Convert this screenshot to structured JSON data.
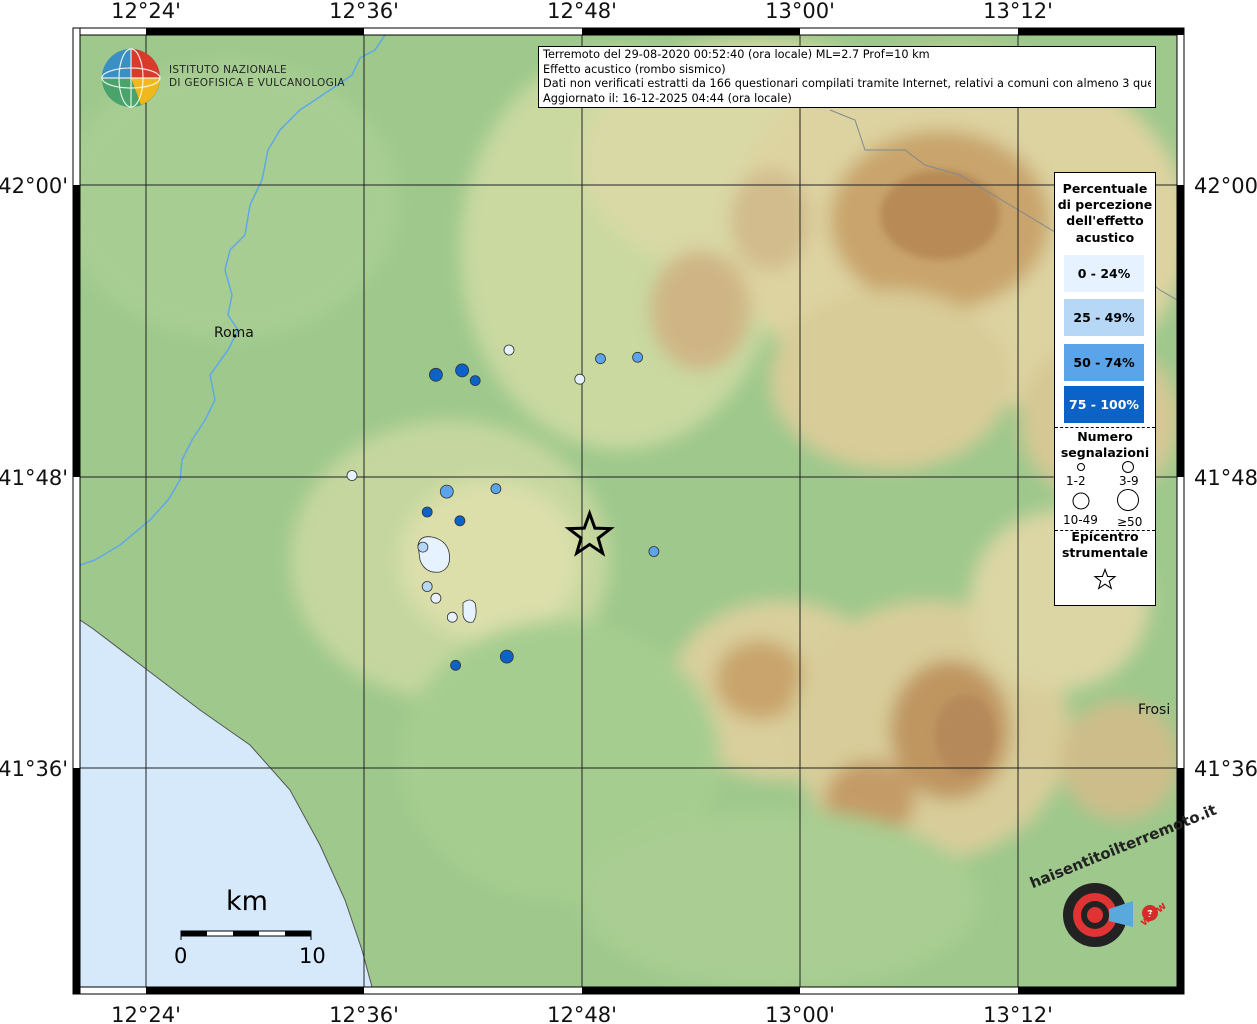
{
  "info": {
    "line1": "Terremoto del 29-08-2020 00:52:40 (ora locale) ML=2.7 Prof=10 km",
    "line2": "Effetto acustico (rombo sismico)",
    "line3": "Dati non verificati estratti da 166 questionari compilati tramite Internet, relativi a comuni con almeno 3 questionari.",
    "line4": "Aggiornato il: 16-12-2025 04:44 (ora locale)"
  },
  "institute": {
    "line1": "ISTITUTO NAZIONALE",
    "line2": "DI GEOFISICA E VULCANOLOGIA"
  },
  "axes": {
    "top": [
      "12°24'",
      "12°36'",
      "12°48'",
      "13°00'",
      "13°12'"
    ],
    "bottom": [
      "12°24'",
      "12°36'",
      "12°48'",
      "13°00'",
      "13°12'"
    ],
    "left": [
      "42°00'",
      "41°48'",
      "41°36'"
    ],
    "right": [
      "42°00'",
      "41°48'",
      "41°36'"
    ]
  },
  "places": {
    "roma": "Roma",
    "frosinone": "Frosi"
  },
  "legend": {
    "title1": "Percentuale",
    "title2": "di percezione",
    "title3": "dell'effetto",
    "title4": "acustico",
    "class1": "0 - 24%",
    "class2": "25 - 49%",
    "class3": "50 - 74%",
    "class4": "75 - 100%",
    "count_title1": "Numero",
    "count_title2": "segnalazioni",
    "size1": "1-2",
    "size2": "3-9",
    "size3": "10-49",
    "size4": "≥50",
    "epi_title1": "Epicentro",
    "epi_title2": "strumentale"
  },
  "colors": {
    "class1": "#e6f2ff",
    "class2": "#b7d7f7",
    "class3": "#5ba4ea",
    "class4": "#0c63c7",
    "sea": "#d5e9fb",
    "lakes": "#e6f2ff",
    "river": "#5fa8e8"
  },
  "scalebar": {
    "unit": "km",
    "min": "0",
    "max": "10"
  },
  "logo2": {
    "text": "haisentitoilterremoto.it",
    "url": "www"
  },
  "observations": [
    {
      "lon": 12.589,
      "lat": 41.801,
      "class": 1,
      "count_class": "1-2"
    },
    {
      "lon": 12.733,
      "lat": 41.887,
      "class": 1,
      "count_class": "1-2"
    },
    {
      "lon": 12.798,
      "lat": 41.867,
      "class": 1,
      "count_class": "1-2"
    },
    {
      "lon": 12.817,
      "lat": 41.881,
      "class": 3,
      "count_class": "1-2"
    },
    {
      "lon": 12.851,
      "lat": 41.882,
      "class": 3,
      "count_class": "1-2"
    },
    {
      "lon": 12.69,
      "lat": 41.873,
      "class": 4,
      "count_class": "3-9"
    },
    {
      "lon": 12.666,
      "lat": 41.87,
      "class": 4,
      "count_class": "3-9"
    },
    {
      "lon": 12.702,
      "lat": 41.866,
      "class": 4,
      "count_class": "1-2"
    },
    {
      "lon": 12.676,
      "lat": 41.79,
      "class": 3,
      "count_class": "3-9"
    },
    {
      "lon": 12.721,
      "lat": 41.792,
      "class": 3,
      "count_class": "1-2"
    },
    {
      "lon": 12.658,
      "lat": 41.776,
      "class": 4,
      "count_class": "1-2"
    },
    {
      "lon": 12.688,
      "lat": 41.77,
      "class": 4,
      "count_class": "1-2"
    },
    {
      "lon": 12.654,
      "lat": 41.752,
      "class": 2,
      "count_class": "1-2"
    },
    {
      "lon": 12.658,
      "lat": 41.725,
      "class": 2,
      "count_class": "1-2"
    },
    {
      "lon": 12.666,
      "lat": 41.717,
      "class": 1,
      "count_class": "1-2"
    },
    {
      "lon": 12.681,
      "lat": 41.704,
      "class": 1,
      "count_class": "1-2"
    },
    {
      "lon": 12.866,
      "lat": 41.749,
      "class": 3,
      "count_class": "1-2"
    },
    {
      "lon": 12.731,
      "lat": 41.677,
      "class": 4,
      "count_class": "3-9"
    },
    {
      "lon": 12.684,
      "lat": 41.671,
      "class": 4,
      "count_class": "1-2"
    }
  ],
  "epicenter": {
    "lon": 12.807,
    "lat": 41.76
  }
}
